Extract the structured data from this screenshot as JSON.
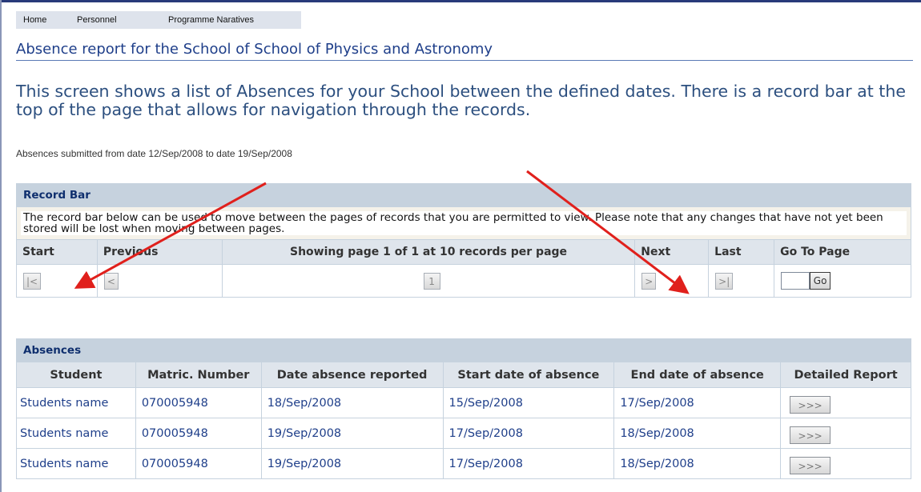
{
  "nav": {
    "items": [
      "Home",
      "Personnel",
      "Programme Naratives"
    ]
  },
  "page": {
    "title": "Absence report for the School of  School of Physics and Astronomy",
    "intro": "This screen shows a list of Absences for your School between the defined dates. There is a record bar at the top of the page that allows for navigation through the records.",
    "dates": "Absences submitted from date 12/Sep/2008 to date 19/Sep/2008"
  },
  "record_bar": {
    "heading": "Record Bar",
    "note": "The record bar below can be used to move between the pages of records that you are permitted to view. Please note that any changes that have not yet been stored will be lost when moving between pages.",
    "columns": {
      "start": "Start",
      "previous": "Previous",
      "showing": "Showing page 1 of 1 at 10 records per page",
      "next": "Next",
      "last": "Last",
      "goto": "Go To Page"
    },
    "buttons": {
      "start": "|<",
      "previous": "<",
      "page": "1",
      "next": ">",
      "last": ">|",
      "go": "Go"
    },
    "goto_value": ""
  },
  "absences": {
    "heading": "Absences",
    "columns": [
      "Student",
      "Matric. Number",
      "Date absence reported",
      "Start date of absence",
      "End date of absence",
      "Detailed Report"
    ],
    "rows": [
      {
        "student": "Students name",
        "matric": "070005948",
        "reported": "18/Sep/2008",
        "start": "15/Sep/2008",
        "end": "17/Sep/2008",
        "detail": ">>>"
      },
      {
        "student": "Students name",
        "matric": "070005948",
        "reported": "19/Sep/2008",
        "start": "17/Sep/2008",
        "end": "18/Sep/2008",
        "detail": ">>>"
      },
      {
        "student": "Students name",
        "matric": "070005948",
        "reported": "19/Sep/2008",
        "start": "17/Sep/2008",
        "end": "18/Sep/2008",
        "detail": ">>>"
      }
    ]
  },
  "colors": {
    "header_bg": "#c6d2de",
    "title": "#1f3f8a",
    "intro": "#2c4f7f",
    "arrow": "#e0201c"
  }
}
